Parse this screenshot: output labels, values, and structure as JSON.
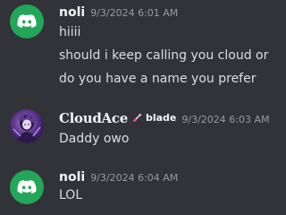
{
  "messages": [
    {
      "author": "noli",
      "timestamp": "9/3/2024 6:01 AM",
      "avatar_icon": "discord-logo-icon",
      "lines": [
        "hiiii",
        "should i keep calling you cloud or",
        "do you have a name you prefer"
      ]
    },
    {
      "author": "CloudAce",
      "tag": "blade",
      "tag_icon": "sword-icon",
      "timestamp": "9/3/2024 6:03 AM",
      "lines": [
        "Daddy owo"
      ]
    },
    {
      "author": "noli",
      "timestamp": "9/3/2024 6:04 AM",
      "avatar_icon": "discord-logo-icon",
      "lines": [
        "LOL"
      ]
    }
  ],
  "colors": {
    "background": "#313338",
    "discord_green": "#23a55a",
    "text": "#dbdee1",
    "muted": "#949ba4"
  }
}
